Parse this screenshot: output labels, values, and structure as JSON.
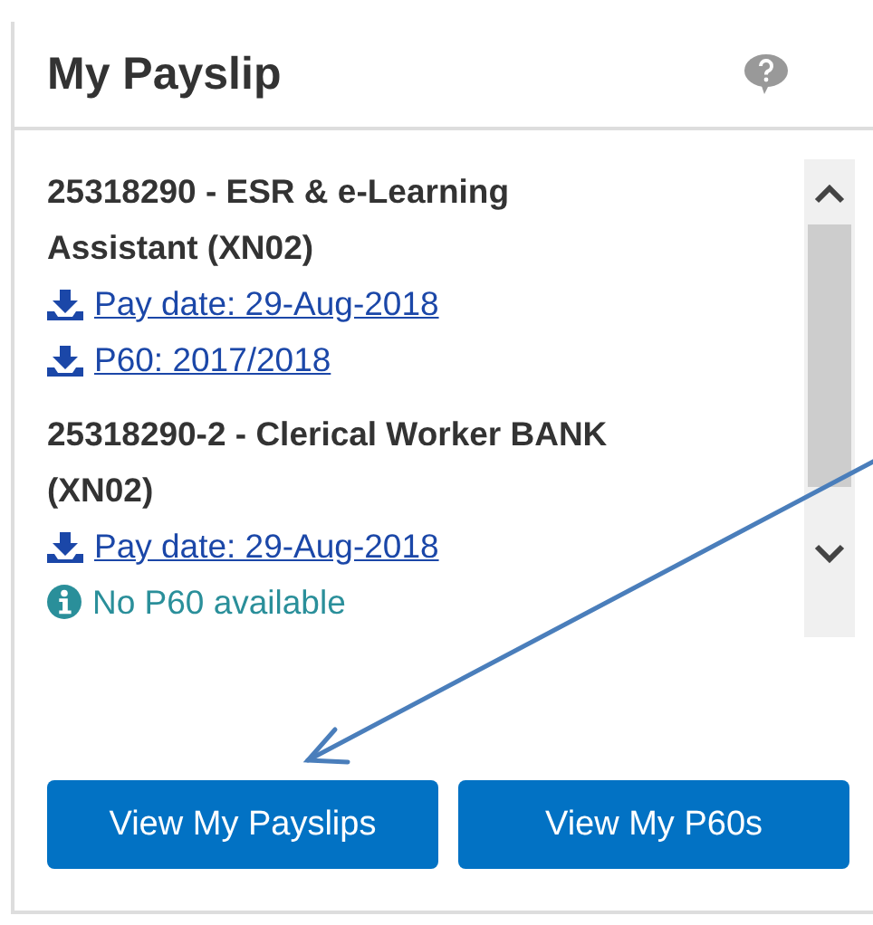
{
  "panel": {
    "title": "My Payslip",
    "jobs": [
      {
        "title": "25318290 - ESR & e-Learning Assistant (XN02)",
        "entries": [
          {
            "kind": "link",
            "text": "Pay date: 29-Aug-2018"
          },
          {
            "kind": "link",
            "text": "P60: 2017/2018"
          }
        ]
      },
      {
        "title": "25318290-2 - Clerical Worker BANK (XN02)",
        "entries": [
          {
            "kind": "link",
            "text": "Pay date: 29-Aug-2018"
          },
          {
            "kind": "info",
            "text": "No P60 available"
          }
        ]
      }
    ],
    "buttons": [
      "View My Payslips",
      "View My P60s"
    ]
  }
}
